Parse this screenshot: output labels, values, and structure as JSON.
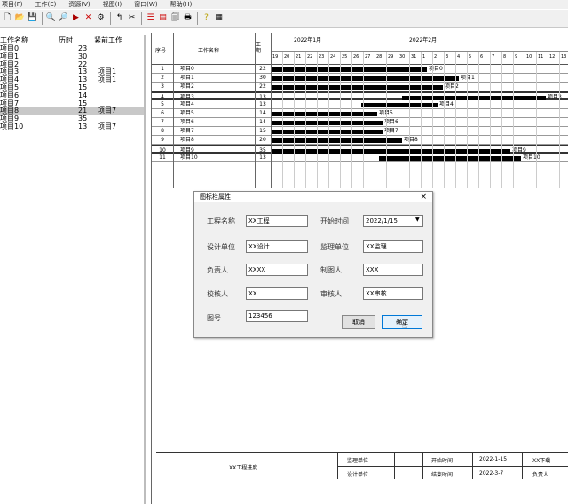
{
  "menu": [
    "项目(F)",
    "工作(E)",
    "资源(V)",
    "视图(I)",
    "窗口(W)",
    "帮助(H)"
  ],
  "toolbar_icons": [
    "new-file-icon",
    "open-folder-icon",
    "save-icon",
    "zoom-in-icon",
    "zoom-out-icon",
    "indent-icon",
    "delete-icon",
    "link-icon",
    "unlink-icon",
    "split-icon",
    "filter-icon",
    "calendar-icon",
    "print-preview-icon",
    "print-icon",
    "help-icon",
    "about-icon"
  ],
  "left_panel": {
    "headers": [
      "工作名称",
      "历时",
      "紧前工作"
    ],
    "rows": [
      {
        "name": "项目0",
        "dur": "23",
        "pred": ""
      },
      {
        "name": "项目1",
        "dur": "30",
        "pred": ""
      },
      {
        "name": "项目2",
        "dur": "22",
        "pred": ""
      },
      {
        "name": "项目3",
        "dur": "13",
        "pred": "项目1"
      },
      {
        "name": "项目4",
        "dur": "13",
        "pred": "项目1"
      },
      {
        "name": "项目5",
        "dur": "15",
        "pred": ""
      },
      {
        "name": "项目6",
        "dur": "14",
        "pred": ""
      },
      {
        "name": "项目7",
        "dur": "15",
        "pred": ""
      },
      {
        "name": "项目8",
        "dur": "21",
        "pred": "项目7"
      },
      {
        "name": "项目9",
        "dur": "35",
        "pred": ""
      },
      {
        "name": "项目10",
        "dur": "13",
        "pred": "项目7"
      }
    ]
  },
  "gantt": {
    "header": {
      "num": "序号",
      "name": "工作名称",
      "dur": "工期",
      "month1": "2022年1月",
      "month2": "2022年2月"
    },
    "rows": [
      {
        "num": "1",
        "name": "项目0",
        "dur": "22",
        "lbl": "项目0"
      },
      {
        "num": "2",
        "name": "项目1",
        "dur": "30",
        "lbl": "项目1"
      },
      {
        "num": "3",
        "name": "项目2",
        "dur": "22",
        "lbl": "项目2"
      },
      {
        "num": "4",
        "name": "项目3",
        "dur": "13",
        "lbl": "项目3"
      },
      {
        "num": "5",
        "name": "项目4",
        "dur": "13",
        "lbl": "项目4"
      },
      {
        "num": "6",
        "name": "项目5",
        "dur": "14",
        "lbl": "项目5"
      },
      {
        "num": "7",
        "name": "项目6",
        "dur": "14",
        "lbl": "项目6"
      },
      {
        "num": "8",
        "name": "项目7",
        "dur": "15",
        "lbl": "项目7"
      },
      {
        "num": "9",
        "name": "项目8",
        "dur": "20",
        "lbl": "项目8"
      },
      {
        "num": "10",
        "name": "项目9",
        "dur": "35",
        "lbl": "项目9"
      },
      {
        "num": "11",
        "name": "项目10",
        "dur": "13",
        "lbl": "项目10"
      }
    ]
  },
  "dialog": {
    "title": "图标栏属性",
    "close": "×",
    "fields": {
      "project_name_label": "工程名称",
      "project_name": "XX工程",
      "start_date_label": "开始时间",
      "start_date": "2022/1/15",
      "design_unit_label": "设计单位",
      "design_unit": "XX设计",
      "supervision_label": "监理单位",
      "supervision": "XX监理",
      "leader_label": "负责人",
      "leader": "XXXX",
      "reviewer_label": "制图人",
      "reviewer": "XXX",
      "checker_label": "校核人",
      "checker": "XX",
      "auditor_label": "审核人",
      "auditor": "XX审核",
      "drawing_no_label": "图号",
      "drawing_no": "123456"
    },
    "cancel": "取消",
    "ok": "确定"
  },
  "footer": {
    "project": "XX工程进度",
    "supervision_label": "监理单位",
    "design_label": "设计单位",
    "start_label": "开始时间",
    "end_label": "结束时间",
    "start_value": "2022-1-15",
    "end_value": "2022-3-7",
    "drawing_label": "XX下载",
    "leader_label": "负责人"
  }
}
